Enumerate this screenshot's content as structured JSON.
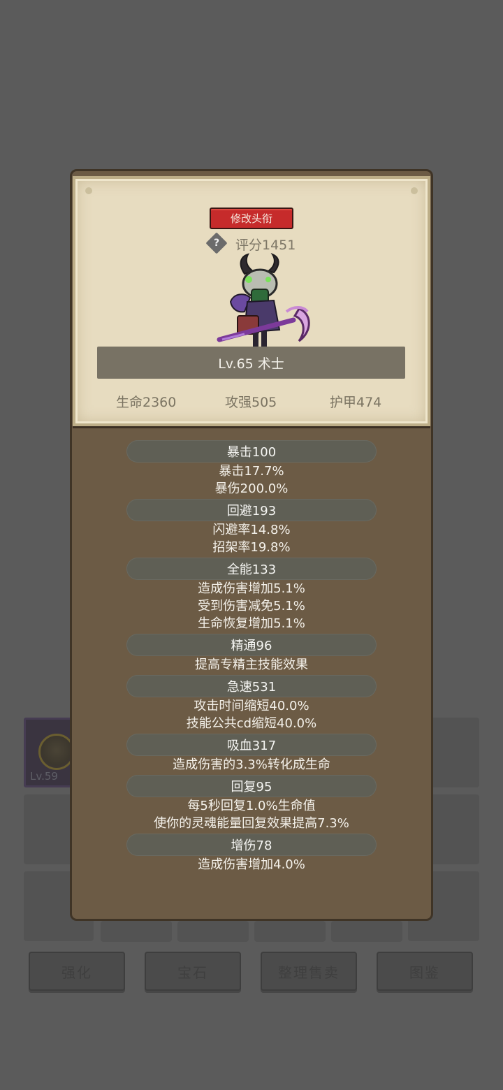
{
  "card": {
    "rename_button": "修改头衔",
    "help_symbol": "?",
    "score": "评分1451",
    "level_class": "Lv.65 术士",
    "base_stats": {
      "hp": "生命2360",
      "attack": "攻强505",
      "armor": "护甲474"
    }
  },
  "stats": [
    {
      "header": "暴击100",
      "lines": [
        "暴击17.7%",
        "暴伤200.0%"
      ]
    },
    {
      "header": "回避193",
      "lines": [
        "闪避率14.8%",
        "招架率19.8%"
      ]
    },
    {
      "header": "全能133",
      "lines": [
        "造成伤害增加5.1%",
        "受到伤害减免5.1%",
        "生命恢复增加5.1%"
      ]
    },
    {
      "header": "精通96",
      "lines": [
        "提高专精主技能效果"
      ]
    },
    {
      "header": "急速531",
      "lines": [
        "攻击时间缩短40.0%",
        "技能公共cd缩短40.0%"
      ]
    },
    {
      "header": "吸血317",
      "lines": [
        "造成伤害的3.3%转化成生命"
      ]
    },
    {
      "header": "回复95",
      "lines": [
        "每5秒回复1.0%生命值",
        "使你的灵魂能量回复效果提高7.3%"
      ]
    },
    {
      "header": "增伤78",
      "lines": [
        "造成伤害增加4.0%"
      ]
    }
  ],
  "background": {
    "inventory_first_item_level": "Lv.59",
    "buttons": [
      "强化",
      "宝石",
      "整理售卖",
      "图鉴"
    ]
  },
  "icons": {
    "help": "question-diamond-icon",
    "hero": "warlock-character-sprite",
    "inventory_badge": "skull-emblem-icon"
  },
  "colors": {
    "rename_button": "#c62b2b",
    "panel": "#6c5b45",
    "card": "#e7dcc0"
  }
}
